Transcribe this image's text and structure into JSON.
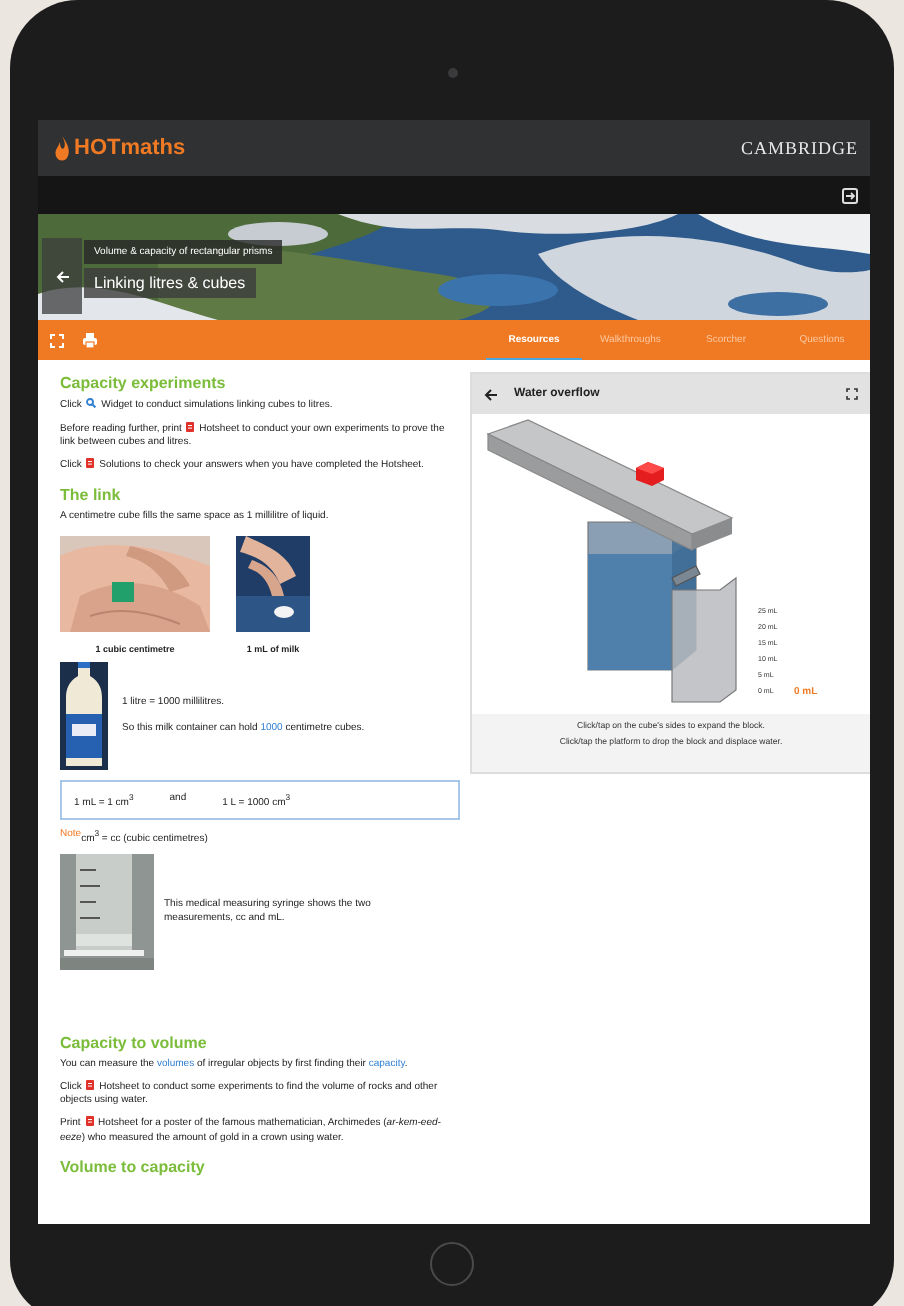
{
  "header": {
    "logo": "HOTmaths",
    "brand": "CAMBRIDGE"
  },
  "banner": {
    "subtitle": "Volume & capacity of rectangular prisms",
    "title": "Linking litres & cubes"
  },
  "tabs": [
    {
      "label": "Resources",
      "selected": true
    },
    {
      "label": "Walkthroughs",
      "selected": false
    },
    {
      "label": "Scorcher",
      "selected": false
    },
    {
      "label": "Questions",
      "selected": false
    }
  ],
  "content": [
    {
      "kind": "heading",
      "text": "Capacity experiments"
    },
    {
      "kind": "para",
      "parts": [
        {
          "kind": "text",
          "text": "Click "
        },
        {
          "kind": "widget"
        },
        {
          "kind": "text",
          "text": " Widget to conduct simulations linking cubes to litres."
        }
      ]
    },
    {
      "kind": "para",
      "parts": [
        {
          "kind": "text",
          "text": "Before reading further, print "
        },
        {
          "kind": "sheet"
        },
        {
          "kind": "text",
          "text": " Hotsheet to conduct your own experiments to prove the link between cubes and litres."
        }
      ]
    },
    {
      "kind": "para",
      "parts": [
        {
          "kind": "text",
          "text": "Click "
        },
        {
          "kind": "sheet"
        },
        {
          "kind": "text",
          "text": " Solutions to check your answers when you have completed the Hotsheet."
        }
      ]
    },
    {
      "kind": "heading",
      "text": "The link"
    },
    {
      "kind": "para",
      "parts": [
        {
          "kind": "text",
          "text": "A centimetre cube fills the same space as 1 millilitre of liquid."
        }
      ]
    },
    {
      "kind": "photos",
      "items": [
        {
          "caption": "1 cubic centimetre"
        },
        {
          "caption": "1 mL of milk"
        }
      ]
    },
    {
      "kind": "bottle",
      "lines": [
        {
          "parts": [
            {
              "kind": "text",
              "text": "1 litre = 1000 millilitres."
            }
          ]
        },
        {
          "parts": [
            {
              "kind": "text",
              "text": "So this milk container can hold "
            },
            {
              "kind": "number",
              "text": "1000"
            },
            {
              "kind": "text",
              "text": " centimetre cubes."
            }
          ]
        }
      ]
    },
    {
      "kind": "formula",
      "items": [
        "1 mL = 1 cm$^{3}$",
        "and",
        "1 L = 1000 cm$^{3}$"
      ]
    },
    {
      "kind": "note",
      "label": "Note",
      "text": " cm$^{3}$ = cc (cubic centimetres)"
    },
    {
      "kind": "syringe",
      "text": "This medical measuring syringe shows the two measurements, cc and mL."
    },
    {
      "kind": "heading",
      "text": "Capacity to volume"
    },
    {
      "kind": "para",
      "parts": [
        {
          "kind": "text",
          "text": "You can measure the "
        },
        {
          "kind": "link",
          "text": "volumes"
        },
        {
          "kind": "text",
          "text": " of irregular objects by first finding their "
        },
        {
          "kind": "link",
          "text": "capacity"
        },
        {
          "kind": "text",
          "text": "."
        }
      ]
    },
    {
      "kind": "para",
      "parts": [
        {
          "kind": "text",
          "text": "Click "
        },
        {
          "kind": "sheet"
        },
        {
          "kind": "text",
          "text": " Hotsheet to conduct some experiments to find the volume of rocks and other objects using water."
        }
      ]
    },
    {
      "kind": "para",
      "parts": [
        {
          "kind": "text",
          "text": "Print "
        },
        {
          "kind": "sheet"
        },
        {
          "kind": "text",
          "text": " Hotsheet for a poster of the famous mathematician, Archimedes (*ar-kem-eed-eeze*) who measured the amount of gold in a crown using water."
        }
      ]
    },
    {
      "kind": "heading",
      "text": "Volume to capacity"
    }
  ],
  "widget": {
    "title": "Water overflow",
    "scale": [
      "25 mL",
      "20 mL",
      "15 mL",
      "10 mL",
      "5 mL",
      "0 mL"
    ],
    "reading": "0 mL",
    "captions": [
      "Click/tap on the cube's sides to expand the block.",
      "Click/tap the platform to drop the block and displace water."
    ]
  }
}
